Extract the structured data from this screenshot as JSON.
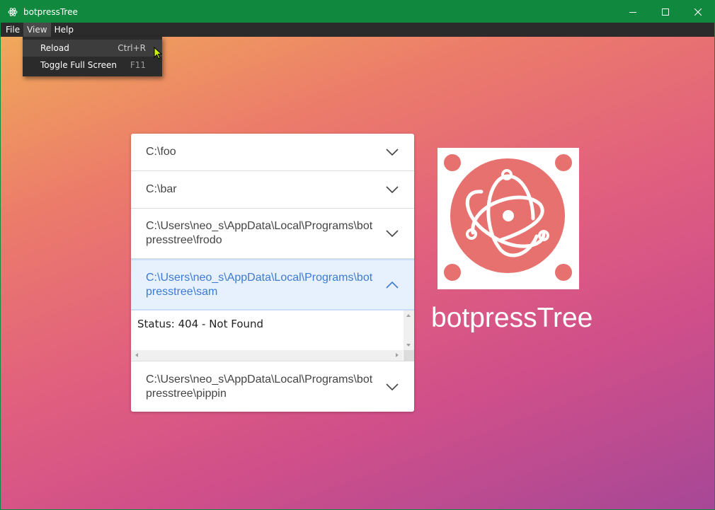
{
  "window": {
    "title": "botpressTree"
  },
  "menubar": {
    "items": [
      {
        "label": "File"
      },
      {
        "label": "View"
      },
      {
        "label": "Help"
      }
    ]
  },
  "view_menu": {
    "items": [
      {
        "label": "Reload",
        "shortcut": "Ctrl+R"
      },
      {
        "label": "Toggle Full Screen",
        "shortcut": "F11"
      }
    ]
  },
  "accordion": {
    "items": [
      {
        "label": "C:\\foo"
      },
      {
        "label": "C:\\bar"
      },
      {
        "label": "C:\\Users\\neo_s\\AppData\\Local\\Programs\\botpresstree\\frodo"
      },
      {
        "label": "C:\\Users\\neo_s\\AppData\\Local\\Programs\\botpresstree\\sam",
        "expanded": true,
        "content": "Status: 404 - Not Found"
      },
      {
        "label": "C:\\Users\\neo_s\\AppData\\Local\\Programs\\botpresstree\\pippin"
      }
    ]
  },
  "brand": {
    "name": "botpressTree"
  },
  "colors": {
    "titlebar": "#10893e",
    "menubar": "#2b2b2b",
    "logo_circle": "#e6716e",
    "expanded_header_text": "#3c7ad6",
    "gradient_top": "#f0a85a",
    "gradient_bottom": "#a64797"
  },
  "icons": {
    "app": "electron-atom-icon",
    "minimize": "minimize-icon",
    "maximize": "maximize-icon",
    "close": "close-icon",
    "expand": "chevron-down-icon",
    "collapse": "chevron-up-icon",
    "logo": "electron-logo"
  }
}
